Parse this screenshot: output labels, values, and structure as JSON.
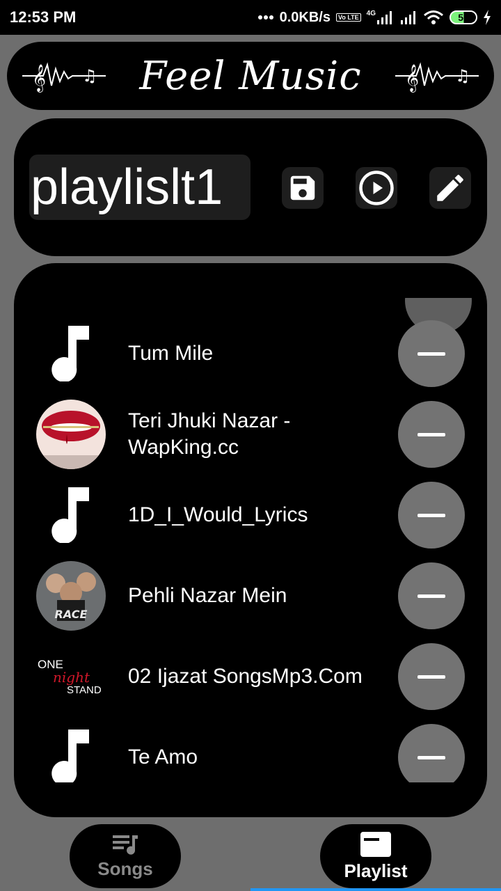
{
  "status_bar": {
    "time": "12:53 PM",
    "network_speed": "0.0KB/s",
    "volte_label": "Vo LTE",
    "network_type": "4G",
    "battery_level": "52",
    "icons": [
      "dots-icon",
      "volte-icon",
      "signal-icon",
      "signal-icon",
      "wifi-icon",
      "battery-icon",
      "charging-icon"
    ]
  },
  "header": {
    "title": "Feel Music",
    "icons": [
      "music-heartbeat-icon",
      "music-heartbeat-icon"
    ]
  },
  "playlist_bar": {
    "name": "playlislt1",
    "buttons": [
      {
        "icon": "save-icon"
      },
      {
        "icon": "play-circle-icon"
      },
      {
        "icon": "edit-pencil-icon"
      }
    ]
  },
  "songs": [
    {
      "title": "Tum Mile",
      "thumb": "music-note-icon"
    },
    {
      "title": "Teri Jhuki Nazar - WapKing.cc",
      "thumb": "album-art"
    },
    {
      "title": "1D_I_Would_Lyrics",
      "thumb": "music-note-icon"
    },
    {
      "title": "Pehli Nazar Mein",
      "thumb": "album-art"
    },
    {
      "title": "02 Ijazat SongsMp3.Com",
      "thumb": "album-art"
    },
    {
      "title": "Te Amo",
      "thumb": "music-note-icon"
    }
  ],
  "album_art_text": {
    "race": "RACE",
    "one_night_stand_line1": "ONE",
    "one_night_stand_line2": "night",
    "one_night_stand_line3": "STAND"
  },
  "bottom_nav": {
    "songs_label": "Songs",
    "playlist_label": "Playlist",
    "active": "Playlist"
  },
  "colors": {
    "background": "#6e6e6e",
    "panel": "#000000",
    "remove_button": "#737373",
    "nav_indicator": "#2196f3",
    "battery": "#7cf27c"
  }
}
